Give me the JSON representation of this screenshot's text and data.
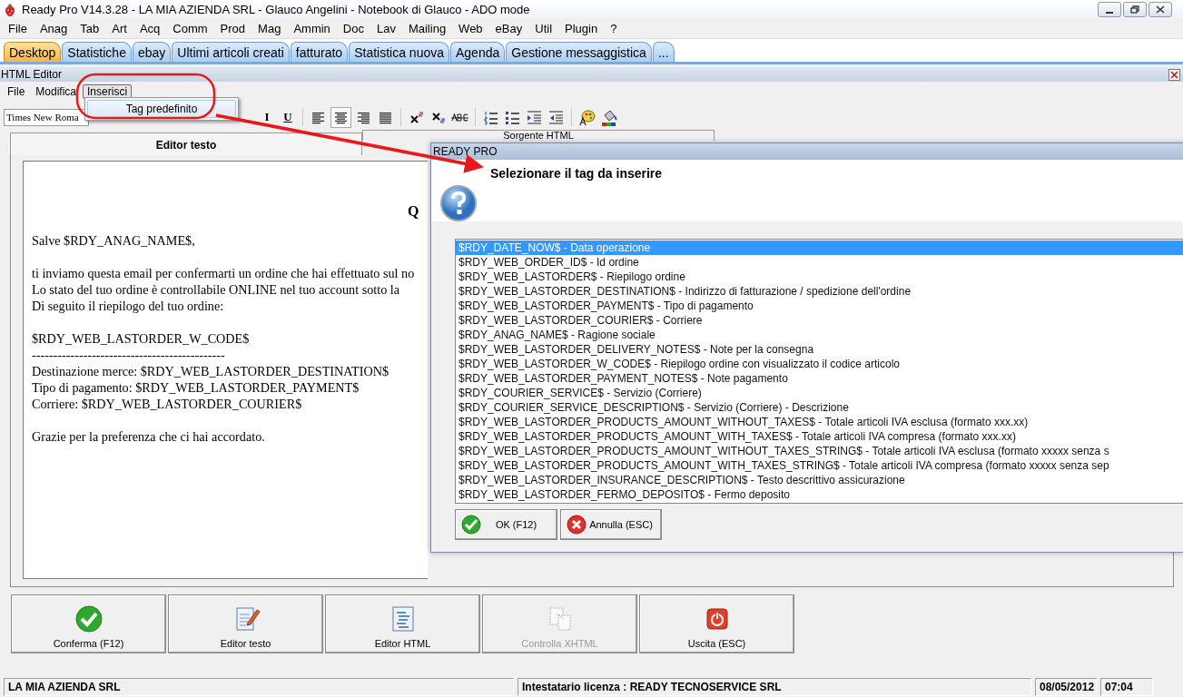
{
  "window": {
    "title": "Ready Pro V14.3.28 - LA MIA AZIENDA SRL - Glauco Angelini - Notebook di Glauco - ADO mode"
  },
  "menu_bar": [
    "File",
    "Anag",
    "Tab",
    "Art",
    "Acq",
    "Comm",
    "Prod",
    "Mag",
    "Ammin",
    "Doc",
    "Lav",
    "Mailing",
    "Web",
    "eBay",
    "Util",
    "Plugin",
    "?"
  ],
  "tabs": [
    {
      "label": "Desktop",
      "selected": true
    },
    {
      "label": "Statistiche",
      "selected": false
    },
    {
      "label": "ebay",
      "selected": false
    },
    {
      "label": "Ultimi articoli creati",
      "selected": false
    },
    {
      "label": "fatturato",
      "selected": false
    },
    {
      "label": "Statistica nuova",
      "selected": false
    },
    {
      "label": "Agenda",
      "selected": false
    },
    {
      "label": "Gestione messaggistica",
      "selected": false
    },
    {
      "label": "...",
      "selected": false
    }
  ],
  "editor": {
    "title": "HTML Editor",
    "menu": [
      {
        "label": "File",
        "open": false
      },
      {
        "label": "Modifica",
        "open": false
      },
      {
        "label": "Inserisci",
        "open": true
      }
    ],
    "dropdown": [
      "Tag predefinito"
    ],
    "font_name": "Times New Roma",
    "format_buttons": [
      "I",
      "U"
    ],
    "editor_tabs": [
      {
        "label": "Editor testo",
        "selected": true
      },
      {
        "label": "Sorgente HTML",
        "selected": false
      }
    ],
    "document": {
      "heading": "Q",
      "blocks": [
        [
          "Salve $RDY_ANAG_NAME$,"
        ],
        [
          "ti inviamo questa email per confermarti un ordine che hai effettuato sul no",
          "Lo stato del tuo ordine è controllabile ONLINE nel tuo account sotto la",
          "Di seguito il riepilogo del tuo ordine:"
        ],
        [
          "$RDY_WEB_LASTORDER_W_CODE$",
          "---------------------------------------------",
          "Destinazione merce: $RDY_WEB_LASTORDER_DESTINATION$",
          "Tipo di pagamento: $RDY_WEB_LASTORDER_PAYMENT$",
          "Corriere: $RDY_WEB_LASTORDER_COURIER$"
        ],
        [
          "Grazie per la preferenza che ci hai accordato."
        ]
      ]
    },
    "actions": [
      {
        "label": "Conferma (F12)",
        "kind": "confirm",
        "disabled": false
      },
      {
        "label": "Editor testo",
        "kind": "text",
        "disabled": false
      },
      {
        "label": "Editor HTML",
        "kind": "html",
        "disabled": false
      },
      {
        "label": "Controlla XHTML",
        "kind": "check",
        "disabled": true
      },
      {
        "label": "Uscita (ESC)",
        "kind": "exit",
        "disabled": false
      }
    ]
  },
  "dialog": {
    "title": "READY PRO",
    "prompt": "Selezionare il tag da inserire",
    "tags": [
      {
        "text": "$RDY_DATE_NOW$ - Data operazione",
        "selected": true
      },
      {
        "text": "$RDY_WEB_ORDER_ID$ - Id ordine",
        "selected": false
      },
      {
        "text": "$RDY_WEB_LASTORDER$ - Riepilogo ordine",
        "selected": false
      },
      {
        "text": "$RDY_WEB_LASTORDER_DESTINATION$ - Indirizzo di fatturazione / spedizione dell'ordine",
        "selected": false
      },
      {
        "text": "$RDY_WEB_LASTORDER_PAYMENT$ - Tipo di pagamento",
        "selected": false
      },
      {
        "text": "$RDY_WEB_LASTORDER_COURIER$ - Corriere",
        "selected": false
      },
      {
        "text": "$RDY_ANAG_NAME$ - Ragione sociale",
        "selected": false
      },
      {
        "text": "$RDY_WEB_LASTORDER_DELIVERY_NOTES$ - Note per la consegna",
        "selected": false
      },
      {
        "text": "$RDY_WEB_LASTORDER_W_CODE$ - Riepilogo ordine con visualizzato il codice articolo",
        "selected": false
      },
      {
        "text": "$RDY_WEB_LASTORDER_PAYMENT_NOTES$ - Note pagamento",
        "selected": false
      },
      {
        "text": "$RDY_COURIER_SERVICE$ - Servizio (Corriere)",
        "selected": false
      },
      {
        "text": "$RDY_COURIER_SERVICE_DESCRIPTION$ - Servizio (Corriere) - Descrizione",
        "selected": false
      },
      {
        "text": "$RDY_WEB_LASTORDER_PRODUCTS_AMOUNT_WITHOUT_TAXES$ - Totale articoli IVA esclusa (formato xxx.xx)",
        "selected": false
      },
      {
        "text": "$RDY_WEB_LASTORDER_PRODUCTS_AMOUNT_WITH_TAXES$ - Totale articoli IVA compresa (formato xxx.xx)",
        "selected": false
      },
      {
        "text": "$RDY_WEB_LASTORDER_PRODUCTS_AMOUNT_WITHOUT_TAXES_STRING$ - Totale articoli IVA esclusa (formato xxxxx senza s",
        "selected": false
      },
      {
        "text": "$RDY_WEB_LASTORDER_PRODUCTS_AMOUNT_WITH_TAXES_STRING$ - Totale articoli IVA compresa (formato xxxxx senza sep",
        "selected": false
      },
      {
        "text": "$RDY_WEB_LASTORDER_INSURANCE_DESCRIPTION$ - Testo descrittivo assicurazione",
        "selected": false
      },
      {
        "text": "$RDY_WEB_LASTORDER_FERMO_DEPOSITO$ - Fermo deposito",
        "selected": false
      }
    ],
    "buttons": [
      {
        "label": "OK (F12)",
        "kind": "ok"
      },
      {
        "label": "Annulla (ESC)",
        "kind": "cancel"
      }
    ]
  },
  "status_bar": [
    "LA MIA AZIENDA SRL",
    "Intestatario licenza : READY TECNOSERVICE SRL",
    "08/05/2012",
    "07:04"
  ]
}
